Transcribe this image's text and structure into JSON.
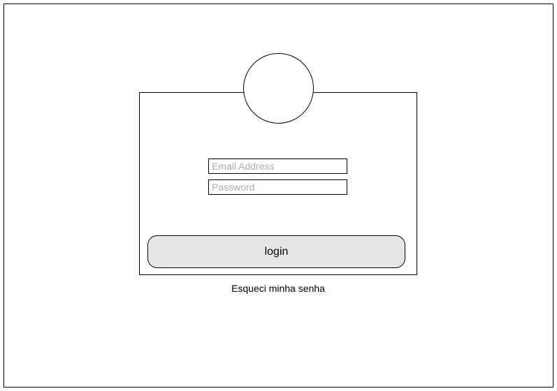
{
  "login_form": {
    "email_placeholder": "Email Address",
    "password_placeholder": "Password",
    "login_label": "login",
    "forgot_password_label": "Esqueci minha senha"
  },
  "colors": {
    "button_background": "#e6e6e6",
    "placeholder_text": "#aaaaaa",
    "border": "#000000"
  }
}
